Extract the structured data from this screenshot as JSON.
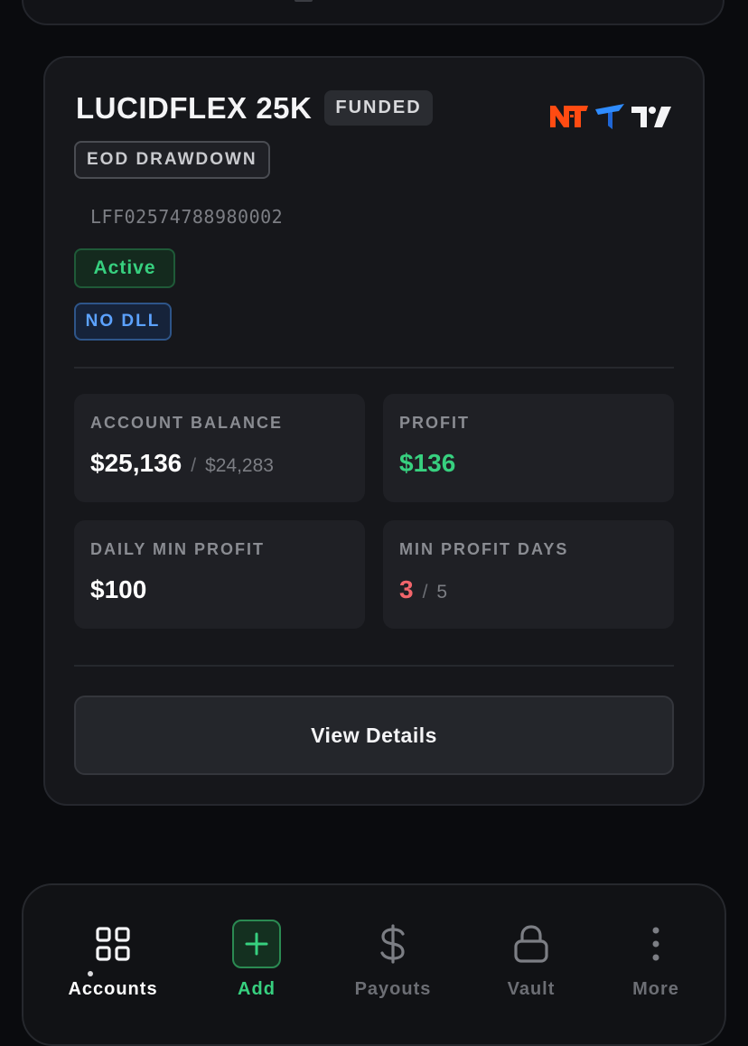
{
  "account_card": {
    "title": "LUCIDFLEX 25K",
    "funded_badge": "FUNDED",
    "drawdown_badge": "EOD DRAWDOWN",
    "account_id": "LFF02574788980002",
    "status_badge": "Active",
    "dll_badge": "NO DLL",
    "platform_icons": [
      "ninjatrader-logo",
      "tradovate-logo",
      "tradingview-logo"
    ],
    "stats": {
      "account_balance": {
        "label": "ACCOUNT BALANCE",
        "value": "$25,136",
        "separator": "/",
        "secondary": "$24,283"
      },
      "profit": {
        "label": "PROFIT",
        "value": "$136"
      },
      "daily_min_profit": {
        "label": "DAILY MIN PROFIT",
        "value": "$100"
      },
      "min_profit_days": {
        "label": "MIN PROFIT DAYS",
        "value": "3",
        "separator": "/",
        "secondary": "5"
      }
    },
    "view_details_label": "View Details"
  },
  "bottom_nav": {
    "items": [
      {
        "label": "Accounts",
        "icon": "grid-icon",
        "active": true
      },
      {
        "label": "Add",
        "icon": "plus-icon"
      },
      {
        "label": "Payouts",
        "icon": "dollar-icon"
      },
      {
        "label": "Vault",
        "icon": "lock-icon"
      },
      {
        "label": "More",
        "icon": "more-vertical-icon"
      }
    ]
  },
  "colors": {
    "background": "#0a0b0e",
    "card": "#16171b",
    "green": "#37d07f",
    "red": "#f2656b",
    "blue": "#5ca2ff",
    "ninjatrader_orange": "#ff4b12",
    "tradovate_blue": "#2f8cff"
  }
}
